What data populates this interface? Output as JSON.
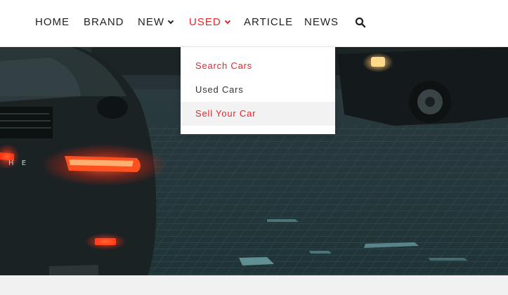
{
  "nav": {
    "items": [
      {
        "label": "HOME"
      },
      {
        "label": "BRAND"
      },
      {
        "label": "NEW"
      },
      {
        "label": "USED"
      },
      {
        "label": "ARTICLE"
      },
      {
        "label": "NEWS"
      }
    ],
    "search_icon": "search-icon",
    "chevron_icon": "chevron-down-icon",
    "active_item": "USED"
  },
  "dropdown": {
    "items": [
      {
        "label": "Search Cars",
        "state": "active"
      },
      {
        "label": "Used Cars",
        "state": "normal"
      },
      {
        "label": "Sell Your Car",
        "state": "hover"
      }
    ]
  },
  "hero": {
    "badge_text": "H E"
  },
  "colors": {
    "accent": "#e3262b",
    "text": "#222222",
    "hover_bg": "#f2f2f2"
  }
}
